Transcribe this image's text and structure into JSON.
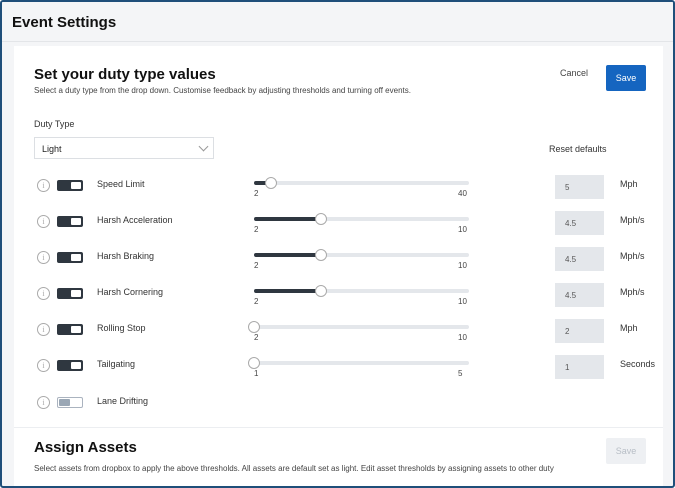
{
  "header": {
    "title": "Event Settings"
  },
  "duty": {
    "title": "Set your duty type values",
    "subtitle": "Select a duty type from the drop down. Customise feedback by adjusting thresholds and turning off events.",
    "cancel_label": "Cancel",
    "save_label": "Save",
    "duty_type_label": "Duty Type",
    "selected_duty": "Light",
    "reset_label": "Reset defaults"
  },
  "events": [
    {
      "label": "Speed Limit",
      "enabled": true,
      "min": "2",
      "max": "40",
      "value": "5",
      "fraction": 0.08,
      "unit": "Mph"
    },
    {
      "label": "Harsh Acceleration",
      "enabled": true,
      "min": "2",
      "max": "10",
      "value": "4.5",
      "fraction": 0.31,
      "unit": "Mph/s"
    },
    {
      "label": "Harsh Braking",
      "enabled": true,
      "min": "2",
      "max": "10",
      "value": "4.5",
      "fraction": 0.31,
      "unit": "Mph/s"
    },
    {
      "label": "Harsh Cornering",
      "enabled": true,
      "min": "2",
      "max": "10",
      "value": "4.5",
      "fraction": 0.31,
      "unit": "Mph/s"
    },
    {
      "label": "Rolling Stop",
      "enabled": true,
      "min": "2",
      "max": "10",
      "value": "2",
      "fraction": 0.0,
      "unit": "Mph"
    },
    {
      "label": "Tailgating",
      "enabled": true,
      "min": "1",
      "max": "5",
      "value": "1",
      "fraction": 0.0,
      "unit": "Seconds"
    },
    {
      "label": "Lane Drifting",
      "enabled": false
    }
  ],
  "assign": {
    "title": "Assign Assets",
    "save_label": "Save",
    "description": "Select assets from dropbox to apply the above thresholds. All assets are default set as light. Edit asset thresholds by assigning assets to other duty"
  },
  "icons": {
    "info": "info-icon",
    "chevron": "chevron-down-icon"
  },
  "colors": {
    "primary": "#1565c0",
    "toggle_on": "#2f3740",
    "frame": "#1f4f7a"
  }
}
